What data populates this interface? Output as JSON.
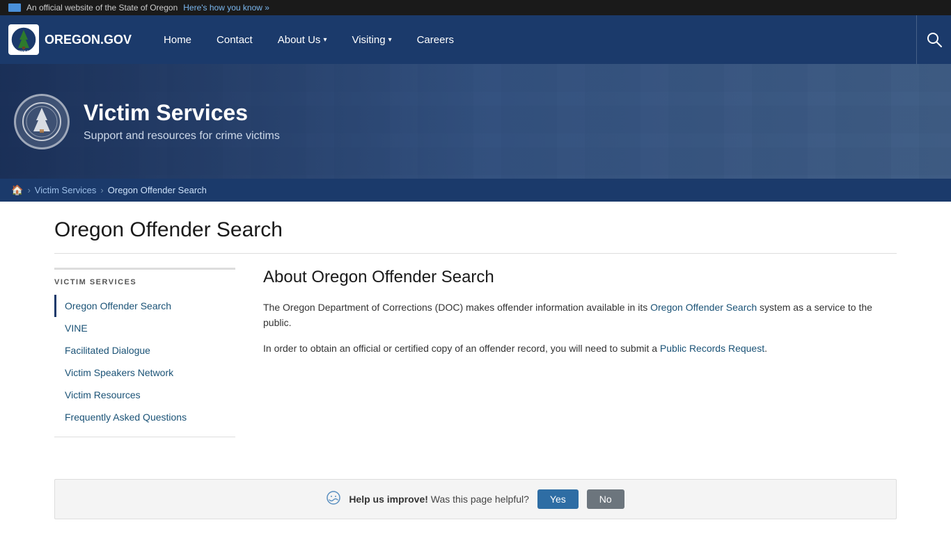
{
  "topbar": {
    "official_text": "An official website of the State of Oregon",
    "how_to_know": "Here's how you know »"
  },
  "nav": {
    "logo_text": "OREGON.GOV",
    "links": [
      {
        "label": "Home",
        "has_dropdown": false
      },
      {
        "label": "Contact",
        "has_dropdown": false
      },
      {
        "label": "About Us",
        "has_dropdown": true
      },
      {
        "label": "Visiting",
        "has_dropdown": true
      },
      {
        "label": "Careers",
        "has_dropdown": false
      }
    ]
  },
  "hero": {
    "title": "Victim Services",
    "subtitle": "Support and resources for crime victims"
  },
  "breadcrumb": {
    "home_label": "🏠",
    "parent": "Victim Services",
    "current": "Oregon Offender Search"
  },
  "page": {
    "title": "Oregon Offender Search",
    "main_heading": "About Oregon Offender Search",
    "paragraph1_start": "The Oregon Department of Corrections (DOC) makes offender information available in its ",
    "paragraph1_link": "Oregon Offender Search",
    "paragraph1_end": " system as a service to the public.",
    "paragraph2_start": "In order to obtain an official or certified copy of an offender record, you will need to submit a ",
    "paragraph2_link": "Public Records Request",
    "paragraph2_end": "."
  },
  "sidebar": {
    "heading": "VICTIM SERVICES",
    "items": [
      {
        "label": "Oregon Offender Search",
        "active": true
      },
      {
        "label": "VINE",
        "active": false
      },
      {
        "label": "Facilitated Dialogue",
        "active": false
      },
      {
        "label": "Victim Speakers Network",
        "active": false
      },
      {
        "label": "Victim Resources",
        "active": false
      },
      {
        "label": "Frequently Asked Questions",
        "active": false
      }
    ]
  },
  "feedback": {
    "prompt_bold": "Help us improve!",
    "prompt": " Was this page helpful?",
    "yes_label": "Yes",
    "no_label": "No"
  }
}
